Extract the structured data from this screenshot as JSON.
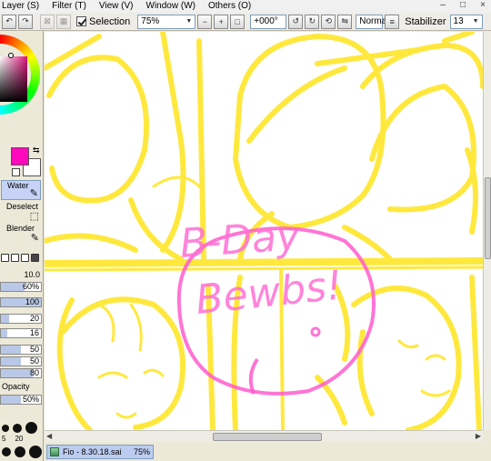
{
  "menu": {
    "items": [
      "Layer (S)",
      "Filter (T)",
      "View (V)",
      "Window (W)",
      "Others (O)"
    ]
  },
  "window_controls": [
    "–",
    "□",
    "×"
  ],
  "toolbar": {
    "selection_label": "Selection",
    "selection_checked": true,
    "zoom_value": "75%",
    "rotation_value": "+000°",
    "mode_value": "Normal",
    "stabilizer_label": "Stabilizer",
    "stabilizer_value": "13"
  },
  "colors": {
    "foreground": "#ff09bd",
    "background": "#ffffff",
    "sketch_yellow": "#ffe629",
    "text_pink": "#ff5ccd",
    "selected_tool_bg": "#c6d3f7"
  },
  "tools": {
    "water_label": "Water",
    "deselect_label": "Deselect",
    "blender_label": "Blender"
  },
  "brush": {
    "size_value": "10.0",
    "min_size_value": "60%",
    "density_value": "100",
    "params": [
      "20",
      "16",
      "50",
      "50",
      "80"
    ],
    "opacity_label": "Opacity",
    "opacity_value": "50%",
    "circle_labels": [
      "5",
      "20"
    ]
  },
  "canvas_text": {
    "line1": "B-Day",
    "line2": "Bewbs!"
  },
  "document": {
    "name": "Fio - 8.30.18.sai",
    "zoom": "75%"
  }
}
